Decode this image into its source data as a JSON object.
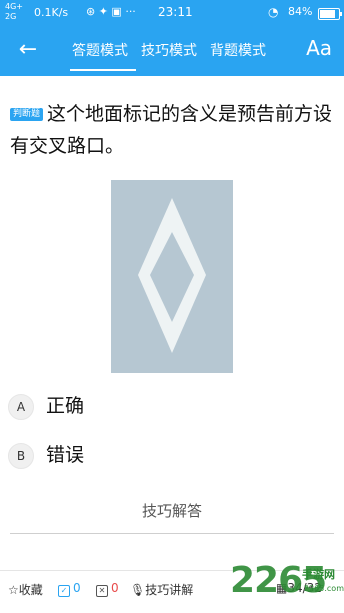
{
  "status_bar": {
    "network_top": "4G+",
    "network_bottom": "2G",
    "speed": "0.1K/s",
    "time": "23:11",
    "battery": "84%",
    "battery_level": 0.84
  },
  "nav": {
    "back_icon": "arrow-left-icon",
    "tabs": [
      "答题模式",
      "技巧模式",
      "背题模式"
    ],
    "active_tab": 0,
    "font_button": "Aa"
  },
  "question": {
    "type_badge": "判断题",
    "text": "这个地面标记的含义是预告前方设有交叉路口。"
  },
  "options": [
    {
      "key": "A",
      "label": "正确"
    },
    {
      "key": "B",
      "label": "错误"
    }
  ],
  "tips_label": "技巧解答",
  "toolbar": {
    "favorite": "☆收藏",
    "correct_count": "0",
    "wrong_count": "0",
    "voice_label": "技巧讲解",
    "page": "34/32"
  },
  "watermark": {
    "number": "2265",
    "name": "手游网",
    "domain": "2265.com"
  },
  "colors": {
    "accent": "#2aa4f1",
    "road_marking_bg": "#b6c7d2"
  }
}
